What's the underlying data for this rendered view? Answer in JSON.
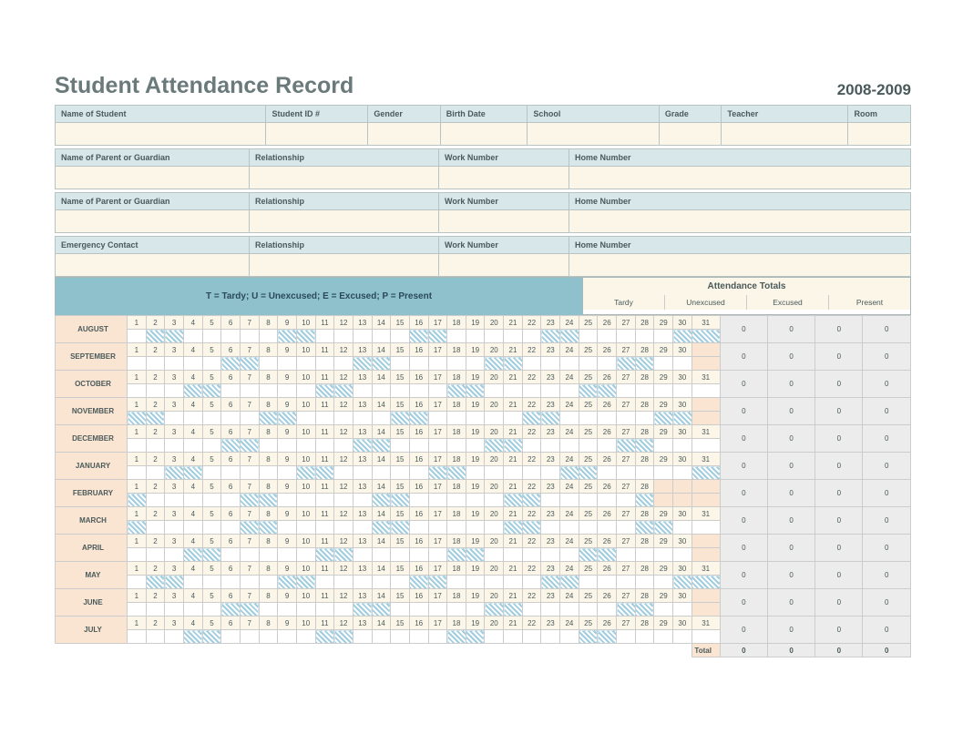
{
  "title": "Student Attendance Record",
  "year_range": "2008-2009",
  "info": {
    "row1": {
      "name_of_student": "Name of Student",
      "student_id": "Student ID #",
      "gender": "Gender",
      "birth_date": "Birth Date",
      "school": "School",
      "grade": "Grade",
      "teacher": "Teacher",
      "room": "Room"
    },
    "parent_label": "Name of Parent or Guardian",
    "relationship": "Relationship",
    "work_number": "Work Number",
    "home_number": "Home Number",
    "emergency_contact": "Emergency Contact"
  },
  "legend": "T = Tardy; U = Unexcused; E = Excused; P = Present",
  "totals_header": "Attendance Totals",
  "totals_cols": {
    "tardy": "Tardy",
    "unexcused": "Unexcused",
    "excused": "Excused",
    "present": "Present"
  },
  "months": [
    {
      "name": "AUGUST",
      "days": 31,
      "weekends": [
        2,
        3,
        9,
        10,
        16,
        17,
        23,
        24,
        30,
        31
      ],
      "tardy": 0,
      "unexcused": 0,
      "excused": 0,
      "present": 0
    },
    {
      "name": "SEPTEMBER",
      "days": 30,
      "weekends": [
        6,
        7,
        13,
        14,
        20,
        21,
        27,
        28
      ],
      "tardy": 0,
      "unexcused": 0,
      "excused": 0,
      "present": 0
    },
    {
      "name": "OCTOBER",
      "days": 31,
      "weekends": [
        4,
        5,
        11,
        12,
        18,
        19,
        25,
        26
      ],
      "tardy": 0,
      "unexcused": 0,
      "excused": 0,
      "present": 0
    },
    {
      "name": "NOVEMBER",
      "days": 30,
      "weekends": [
        1,
        2,
        8,
        9,
        15,
        16,
        22,
        23,
        29,
        30
      ],
      "tardy": 0,
      "unexcused": 0,
      "excused": 0,
      "present": 0
    },
    {
      "name": "DECEMBER",
      "days": 31,
      "weekends": [
        6,
        7,
        13,
        14,
        20,
        21,
        27,
        28
      ],
      "tardy": 0,
      "unexcused": 0,
      "excused": 0,
      "present": 0
    },
    {
      "name": "JANUARY",
      "days": 31,
      "weekends": [
        3,
        4,
        10,
        11,
        17,
        18,
        24,
        25,
        31
      ],
      "tardy": 0,
      "unexcused": 0,
      "excused": 0,
      "present": 0
    },
    {
      "name": "FEBRUARY",
      "days": 28,
      "weekends": [
        1,
        7,
        8,
        14,
        15,
        21,
        22,
        28
      ],
      "tardy": 0,
      "unexcused": 0,
      "excused": 0,
      "present": 0
    },
    {
      "name": "MARCH",
      "days": 31,
      "weekends": [
        1,
        7,
        8,
        14,
        15,
        21,
        22,
        28,
        29
      ],
      "tardy": 0,
      "unexcused": 0,
      "excused": 0,
      "present": 0
    },
    {
      "name": "APRIL",
      "days": 30,
      "weekends": [
        4,
        5,
        11,
        12,
        18,
        19,
        25,
        26
      ],
      "tardy": 0,
      "unexcused": 0,
      "excused": 0,
      "present": 0
    },
    {
      "name": "MAY",
      "days": 31,
      "weekends": [
        2,
        3,
        9,
        10,
        16,
        17,
        23,
        24,
        30,
        31
      ],
      "tardy": 0,
      "unexcused": 0,
      "excused": 0,
      "present": 0
    },
    {
      "name": "JUNE",
      "days": 30,
      "weekends": [
        6,
        7,
        13,
        14,
        20,
        21,
        27,
        28
      ],
      "tardy": 0,
      "unexcused": 0,
      "excused": 0,
      "present": 0
    },
    {
      "name": "JULY",
      "days": 31,
      "weekends": [
        4,
        5,
        11,
        12,
        18,
        19,
        25,
        26
      ],
      "tardy": 0,
      "unexcused": 0,
      "excused": 0,
      "present": 0
    }
  ],
  "grand_total_label": "Total",
  "grand_total": {
    "tardy": 0,
    "unexcused": 0,
    "excused": 0,
    "present": 0
  }
}
